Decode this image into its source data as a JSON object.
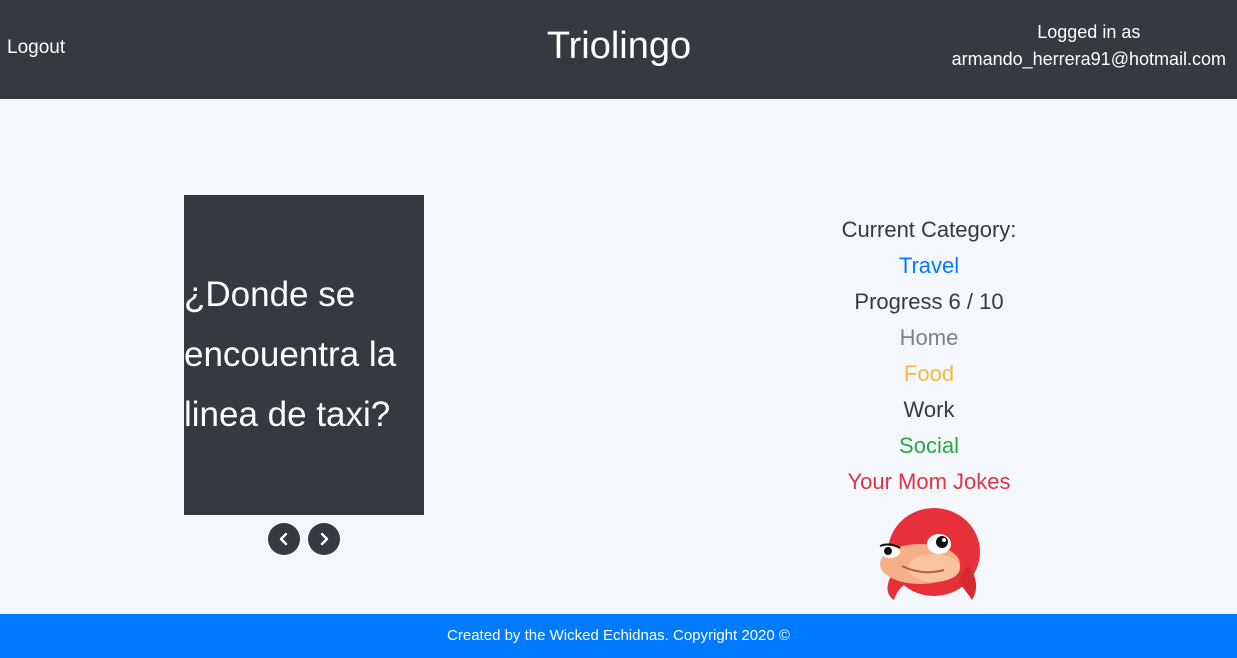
{
  "header": {
    "logout_label": "Logout",
    "brand": "Triolingo",
    "logged_in_label": "Logged in as",
    "user_email": "armando_herrera91@hotmail.com"
  },
  "flashcard": {
    "text": "¿Donde se encouentra la linea de taxi?",
    "prev_icon": "chevron-left-icon",
    "next_icon": "chevron-right-icon"
  },
  "categories": {
    "current_label": "Current Category:",
    "current": "Travel",
    "progress": "Progress 6 / 10",
    "items": [
      {
        "label": "Home",
        "color": "#808080"
      },
      {
        "label": "Food",
        "color": "#f5b942"
      },
      {
        "label": "Work",
        "color": "#343a40"
      },
      {
        "label": "Social",
        "color": "#28a745"
      },
      {
        "label": "Your Mom Jokes",
        "color": "#dc3545"
      }
    ],
    "current_color": "#007bff",
    "mascot_icon": "knuckles-mascot-icon"
  },
  "footer": {
    "text": "Created by the Wicked Echidnas. Copyright 2020 ©"
  },
  "colors": {
    "navbar": "#343a40",
    "footer": "#007bff",
    "background": "#f4f8fc"
  }
}
